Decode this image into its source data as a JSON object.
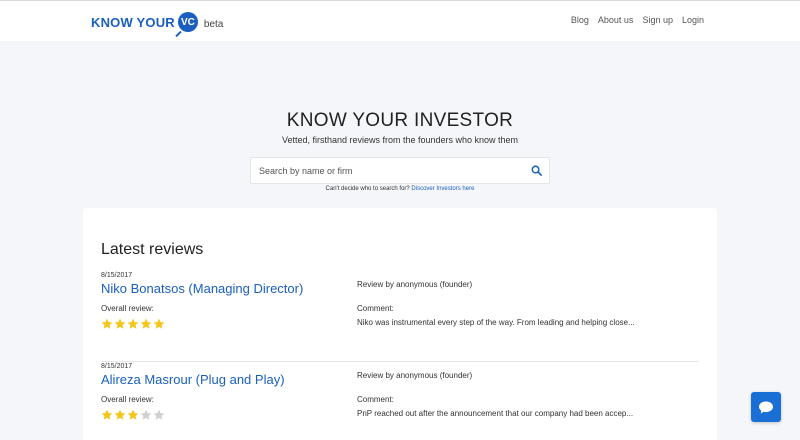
{
  "header": {
    "logo_text": "KNOW YOUR",
    "logo_badge": "VC",
    "logo_beta": "beta",
    "nav": [
      {
        "label": "Blog"
      },
      {
        "label": "About us"
      },
      {
        "label": "Sign up"
      },
      {
        "label": "Login"
      }
    ]
  },
  "hero": {
    "title": "KNOW YOUR INVESTOR",
    "subtitle": "Vetted, firsthand reviews from the founders who know them"
  },
  "search": {
    "placeholder": "Search by name or firm",
    "value": ""
  },
  "helper": {
    "text": "Can't decide who to search for?",
    "link": "Discover Investors here"
  },
  "reviews_section": {
    "title": "Latest reviews",
    "items": [
      {
        "date": "8/15/2017",
        "name": "Niko Bonatsos (Managing Director)",
        "overall_label": "Overall review:",
        "rating": 5,
        "max_rating": 5,
        "reviewer": "Review by anonymous (founder)",
        "comment_label": "Comment:",
        "comment": "Niko was instrumental every step of the way. From leading and helping close..."
      },
      {
        "date": "8/15/2017",
        "name": "Alireza Masrour (Plug and Play)",
        "overall_label": "Overall review:",
        "rating": 3,
        "max_rating": 5,
        "reviewer": "Review by anonymous (founder)",
        "comment_label": "Comment:",
        "comment": "PnP reached out after the announcement that our company had been accep..."
      }
    ]
  },
  "colors": {
    "accent": "#1a5fbf",
    "star_filled": "#f5c518",
    "star_empty": "#d0d0d0",
    "chat_button": "#1a6fd6"
  },
  "icons": {
    "search": "search-icon",
    "chat": "chat-icon",
    "star": "star-icon"
  }
}
